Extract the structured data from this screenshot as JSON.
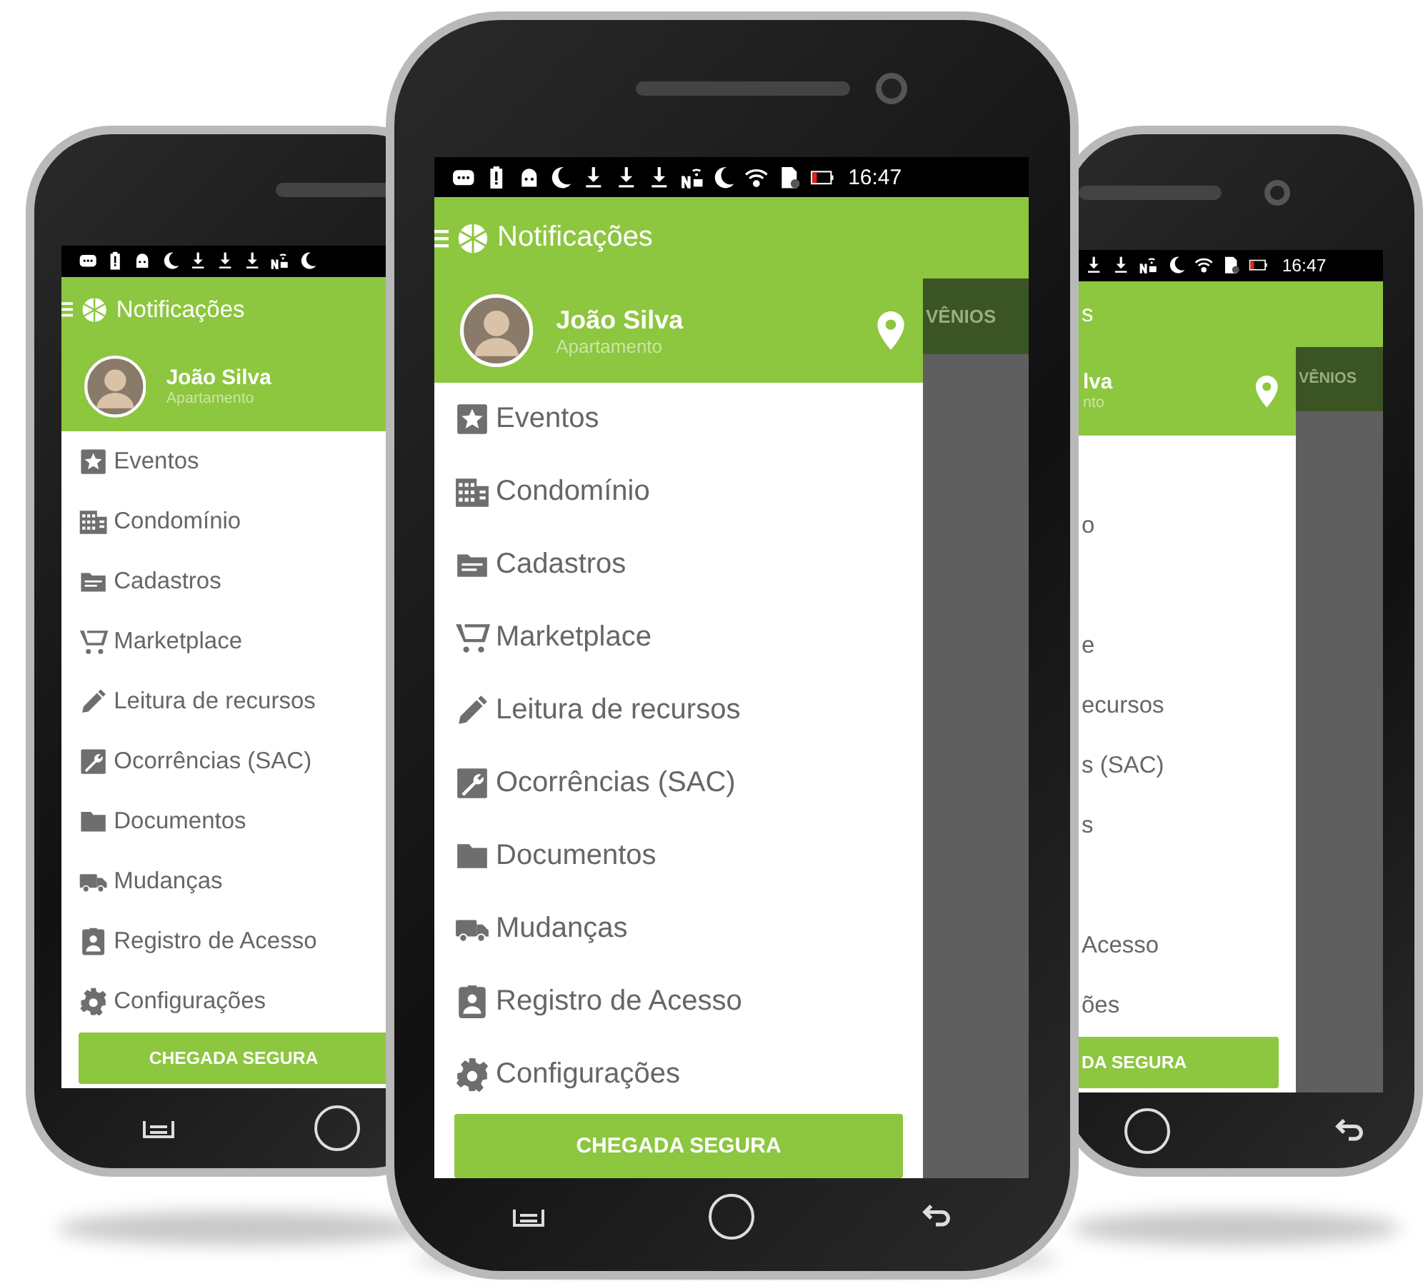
{
  "left_phone": {
    "app_bar": {
      "title": "Notificações"
    },
    "drawer": {
      "user_name": "João Silva",
      "user_unit": "Apartamento",
      "menu": [
        {
          "label": "Eventos"
        },
        {
          "label": "Condomínio"
        },
        {
          "label": "Cadastros"
        },
        {
          "label": "Marketplace"
        },
        {
          "label": "Leitura de recursos"
        },
        {
          "label": "Ocorrências (SAC)"
        },
        {
          "label": "Documentos"
        },
        {
          "label": "Mudanças"
        },
        {
          "label": "Registro de Acesso"
        },
        {
          "label": "Configurações"
        }
      ],
      "button": "CHEGADA SEGURA"
    }
  },
  "center_phone": {
    "status_bar": {
      "time": "16:47"
    },
    "app_bar": {
      "title": "Notificações"
    },
    "drawer": {
      "user_name": "João Silva",
      "user_unit": "Apartamento",
      "menu": [
        {
          "label": "Eventos"
        },
        {
          "label": "Condomínio"
        },
        {
          "label": "Cadastros"
        },
        {
          "label": "Marketplace"
        },
        {
          "label": "Leitura de recursos"
        },
        {
          "label": "Ocorrências (SAC)"
        },
        {
          "label": "Documentos"
        },
        {
          "label": "Mudanças"
        },
        {
          "label": "Registro de Acesso"
        },
        {
          "label": "Configurações"
        }
      ],
      "button": "CHEGADA SEGURA"
    },
    "background_tab": "VÊNIOS"
  },
  "right_phone": {
    "status_bar": {
      "time": "16:47"
    },
    "app_bar": {
      "title": "s"
    },
    "drawer": {
      "user_name": "lva",
      "user_unit": "nto",
      "menu": [
        {
          "kind": "covered"
        },
        {
          "kind": "text",
          "label": "o"
        },
        {
          "kind": "covered"
        },
        {
          "kind": "text",
          "label": "e"
        },
        {
          "kind": "text",
          "label": "ecursos"
        },
        {
          "kind": "text",
          "label": "s (SAC)"
        },
        {
          "kind": "text",
          "label": "s"
        },
        {
          "kind": "covered"
        },
        {
          "kind": "text",
          "label": "Acesso"
        },
        {
          "kind": "text",
          "label": "ões"
        }
      ],
      "button": "DA SEGURA"
    },
    "background_tab": "VÊNIOS"
  }
}
